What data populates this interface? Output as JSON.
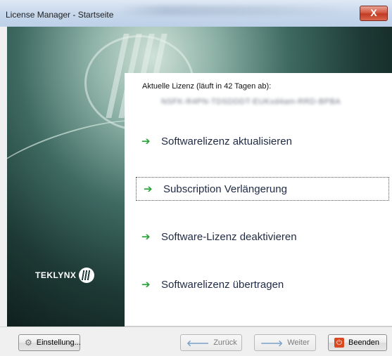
{
  "window": {
    "title": "License Manager - Startseite",
    "close_label": "X"
  },
  "license": {
    "label": "Aktuelle Lizenz (läuft in 42 Tagen ab):",
    "key": "NSFK-R4PN-TDSDDDT-EUKxd4am-RRD-BPBA"
  },
  "actions": [
    {
      "label": "Softwarelizenz aktualisieren",
      "icon": "green-arrow-icon"
    },
    {
      "label": "Subscription Verlängerung",
      "icon": "green-arrow-icon",
      "selected": true
    },
    {
      "label": "Software-Lizenz deaktivieren",
      "icon": "green-arrow-icon"
    },
    {
      "label": "Softwarelizenz übertragen",
      "icon": "green-arrow-icon"
    }
  ],
  "brand": {
    "name": "TEKLYNX"
  },
  "buttons": {
    "settings": "Einstellung...",
    "back": "Zurück",
    "next": "Weiter",
    "exit": "Beenden"
  }
}
